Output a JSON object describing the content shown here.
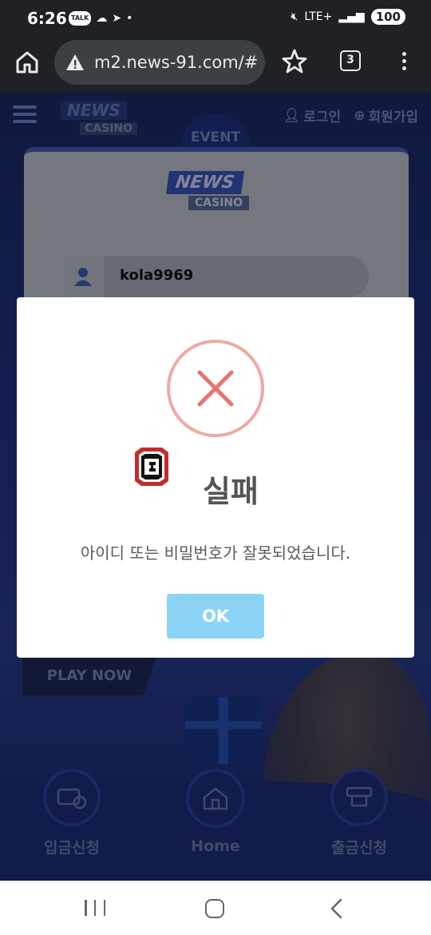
{
  "status_bar": {
    "time": "6:26",
    "talk_badge": "TALK",
    "network": "LTE+",
    "battery": "100"
  },
  "browser": {
    "url": "m2.news-91.com/#",
    "tab_count": "3"
  },
  "site": {
    "logo_news": "NEWS",
    "logo_casino": "CASINO",
    "event_tab": "EVENT",
    "login_link": "로그인",
    "signup_link": "회원가입",
    "username_value": "kola9969",
    "play_now": "PLAY NOW",
    "bottom_nav": [
      {
        "label": "입금신청"
      },
      {
        "label": "Home"
      },
      {
        "label": "출금신청"
      }
    ]
  },
  "modal": {
    "title": "실패",
    "message": "아이디 또는 비밀번호가 잘못되었습니다.",
    "ok_label": "OK",
    "error_color": "#e8746f",
    "ok_color": "#8cd4f5"
  }
}
